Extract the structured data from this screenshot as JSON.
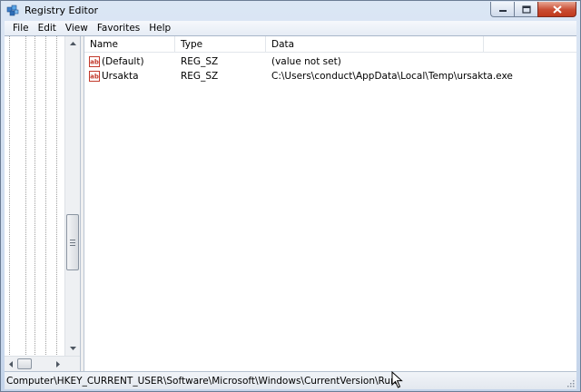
{
  "window": {
    "title": "Registry Editor",
    "icon": "registry-editor-icon"
  },
  "menu": [
    {
      "label": "File"
    },
    {
      "label": "Edit"
    },
    {
      "label": "View"
    },
    {
      "label": "Favorites"
    },
    {
      "label": "Help"
    }
  ],
  "list": {
    "columns": {
      "name": "Name",
      "type": "Type",
      "data": "Data"
    },
    "rows": [
      {
        "name": "(Default)",
        "type": "REG_SZ",
        "data": "(value not set)",
        "icon": "string-value-icon"
      },
      {
        "name": "Ursakta",
        "type": "REG_SZ",
        "data": "C:\\Users\\conduct\\AppData\\Local\\Temp\\ursakta.exe",
        "icon": "string-value-icon"
      }
    ]
  },
  "status": {
    "path": "Computer\\HKEY_CURRENT_USER\\Software\\Microsoft\\Windows\\CurrentVersion\\Run"
  }
}
